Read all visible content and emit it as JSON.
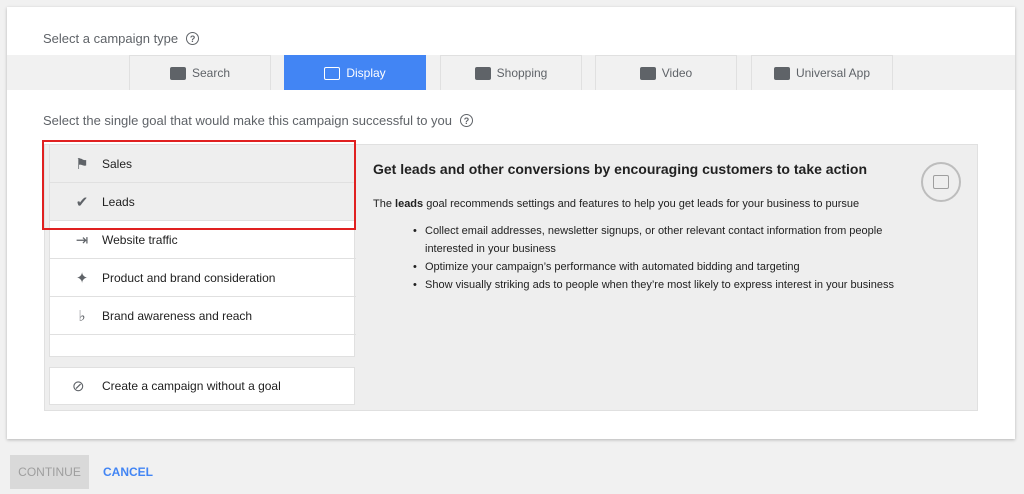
{
  "campaign_type": {
    "label": "Select a campaign type",
    "tabs": [
      {
        "label": "Search",
        "icon": "search-icon"
      },
      {
        "label": "Display",
        "icon": "display-icon",
        "active": true
      },
      {
        "label": "Shopping",
        "icon": "tag-icon"
      },
      {
        "label": "Video",
        "icon": "video-icon"
      },
      {
        "label": "Universal App",
        "icon": "app-icon"
      }
    ]
  },
  "goal": {
    "label": "Select the single goal that would make this campaign successful to you",
    "items": [
      {
        "label": "Sales",
        "icon": "tag-icon"
      },
      {
        "label": "Leads",
        "icon": "check-circle-icon",
        "selected": true
      },
      {
        "label": "Website traffic",
        "icon": "arrow-in-icon"
      },
      {
        "label": "Product and brand consideration",
        "icon": "sparkle-icon"
      },
      {
        "label": "Brand awareness and reach",
        "icon": "speaker-icon"
      }
    ],
    "no_goal": "Create a campaign without a goal"
  },
  "detail": {
    "title": "Get leads and other conversions by encouraging customers to take action",
    "intro_prefix": "The ",
    "intro_bold": "leads",
    "intro_suffix": " goal recommends settings and features to help you get leads for your business to pursue",
    "bullets": [
      "Collect email addresses, newsletter signups, or other relevant contact information from people interested in your business",
      "Optimize your campaign’s performance with automated bidding and targeting",
      "Show visually striking ads to people when they’re most likely to express interest in your business"
    ]
  },
  "actions": {
    "continue": "CONTINUE",
    "cancel": "CANCEL"
  },
  "colors": {
    "accent": "#4285f4",
    "highlight": "#e02020"
  }
}
